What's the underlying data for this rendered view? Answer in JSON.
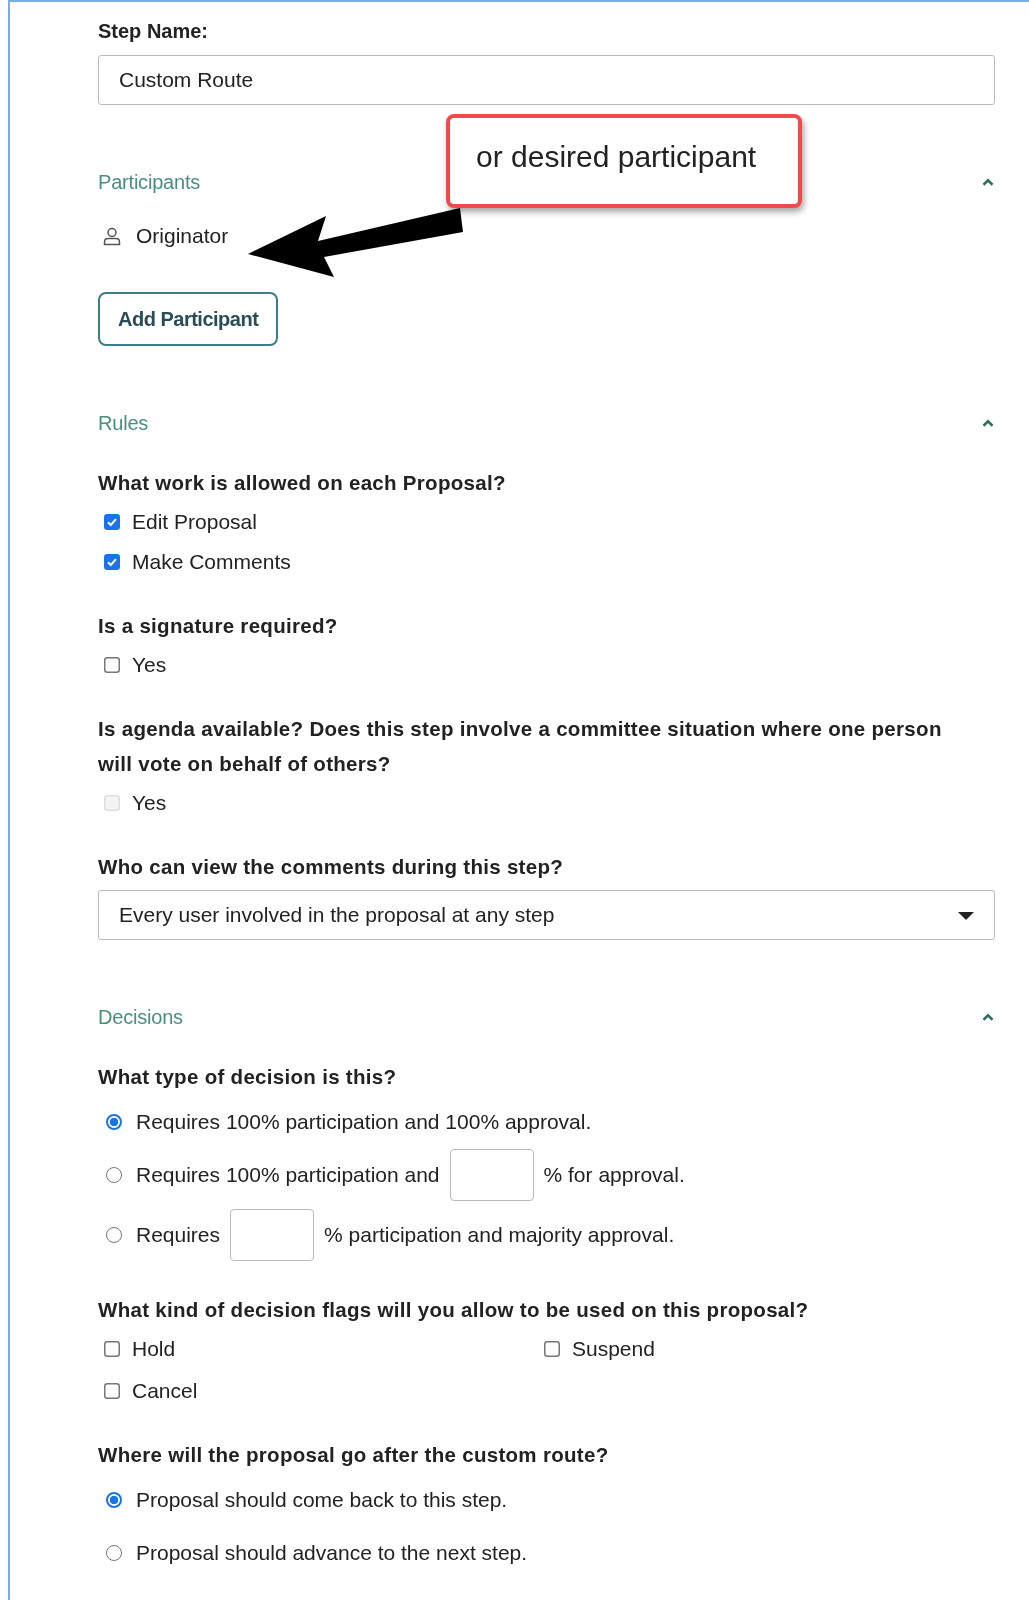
{
  "step_name": {
    "label": "Step Name:",
    "value": "Custom Route"
  },
  "participants": {
    "title": "Participants",
    "expanded": true,
    "items": [
      "Originator"
    ],
    "add_button": "Add Participant"
  },
  "callout": {
    "text": "or desired participant"
  },
  "rules": {
    "title": "Rules",
    "expanded": true,
    "questions": [
      {
        "kind": "checkboxes",
        "question": "What work is allowed on each Proposal?",
        "options": [
          {
            "label": "Edit Proposal",
            "checked": true,
            "disabled": false
          },
          {
            "label": "Make Comments",
            "checked": true,
            "disabled": false
          }
        ]
      },
      {
        "kind": "checkboxes",
        "question": "Is a signature required?",
        "options": [
          {
            "label": "Yes",
            "checked": false,
            "disabled": false
          }
        ]
      },
      {
        "kind": "checkboxes",
        "question": "Is agenda available? Does this step involve a committee situation where one person will vote on behalf of others?",
        "options": [
          {
            "label": "Yes",
            "checked": false,
            "disabled": true
          }
        ]
      },
      {
        "kind": "select",
        "question": "Who can view the comments during this step?",
        "value": "Every user involved in the proposal at any step"
      }
    ]
  },
  "decisions": {
    "title": "Decisions",
    "expanded": true,
    "questions": [
      {
        "kind": "radios",
        "question": "What type of decision is this?",
        "options": [
          {
            "selected": true,
            "parts": [
              {
                "kind": "text",
                "text": "Requires 100% participation and 100% approval."
              }
            ]
          },
          {
            "selected": false,
            "parts": [
              {
                "kind": "text",
                "text": "Requires 100% participation and"
              },
              {
                "kind": "input"
              },
              {
                "kind": "text",
                "text": "% for approval."
              }
            ]
          },
          {
            "selected": false,
            "parts": [
              {
                "kind": "text",
                "text": "Requires"
              },
              {
                "kind": "input"
              },
              {
                "kind": "text",
                "text": "% participation and majority approval."
              }
            ]
          }
        ]
      },
      {
        "kind": "grid",
        "question": "What kind of decision flags will you allow to be used on this proposal?",
        "options": [
          {
            "label": "Hold",
            "checked": false,
            "disabled": false
          },
          {
            "label": "Suspend",
            "checked": false,
            "disabled": false
          },
          {
            "label": "Cancel",
            "checked": false,
            "disabled": false
          }
        ]
      },
      {
        "kind": "radios",
        "question": "Where will the proposal go after the custom route?",
        "options": [
          {
            "selected": true,
            "parts": [
              {
                "kind": "text",
                "text": "Proposal should come back to this step."
              }
            ]
          },
          {
            "selected": false,
            "parts": [
              {
                "kind": "text",
                "text": "Proposal should advance to the next step."
              }
            ]
          }
        ]
      }
    ]
  }
}
